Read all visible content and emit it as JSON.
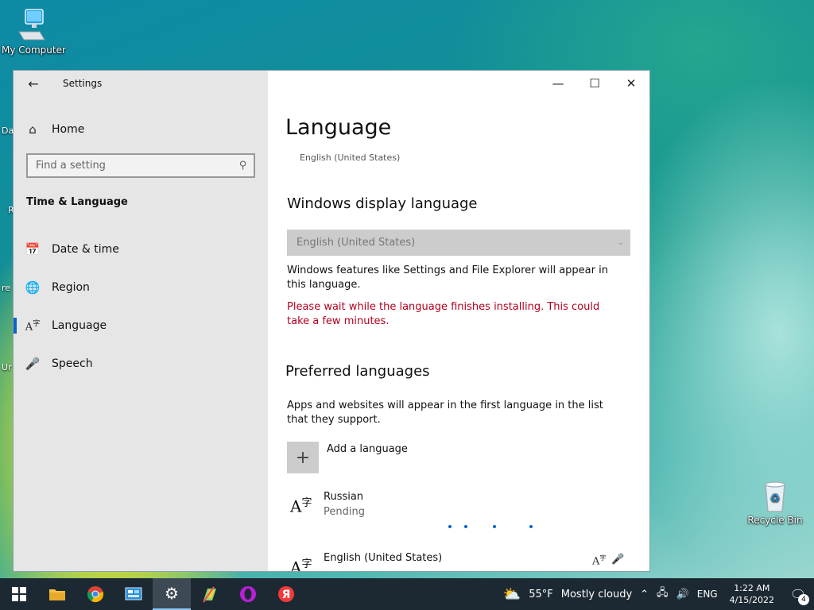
{
  "desktop": {
    "my_computer_label": "My Computer",
    "recycle_bin_label": "Recycle Bin",
    "partial_labels": [
      "Da",
      "R",
      "re",
      "Ur"
    ]
  },
  "window": {
    "app_title": "Settings",
    "sidebar": {
      "home_label": "Home",
      "search_placeholder": "Find a setting",
      "section_title": "Time & Language",
      "items": [
        {
          "label": "Date & time",
          "icon": "calendar-clock-icon"
        },
        {
          "label": "Region",
          "icon": "globe-icon"
        },
        {
          "label": "Language",
          "icon": "language-icon",
          "active": true
        },
        {
          "label": "Speech",
          "icon": "microphone-icon"
        }
      ]
    },
    "main": {
      "page_title": "Language",
      "current_language": "English (United States)",
      "display_language": {
        "heading": "Windows display language",
        "selected": "English (United States)",
        "description": "Windows features like Settings and File Explorer will appear in this language.",
        "warning": "Please wait while the language finishes installing. This could take a few minutes."
      },
      "preferred": {
        "heading": "Preferred languages",
        "description": "Apps and websites will appear in the first language in the list that they support.",
        "add_label": "Add a language",
        "languages": [
          {
            "name": "Russian",
            "status": "Pending"
          },
          {
            "name": "English (United States)",
            "status": ""
          }
        ]
      }
    }
  },
  "taskbar": {
    "weather_temp": "55°F",
    "weather_text": "Mostly cloudy",
    "input_lang": "ENG",
    "time": "1:22 AM",
    "date": "4/15/2022",
    "notification_count": "4",
    "accent": "#0a64c8",
    "warning_color": "#b4001e"
  }
}
